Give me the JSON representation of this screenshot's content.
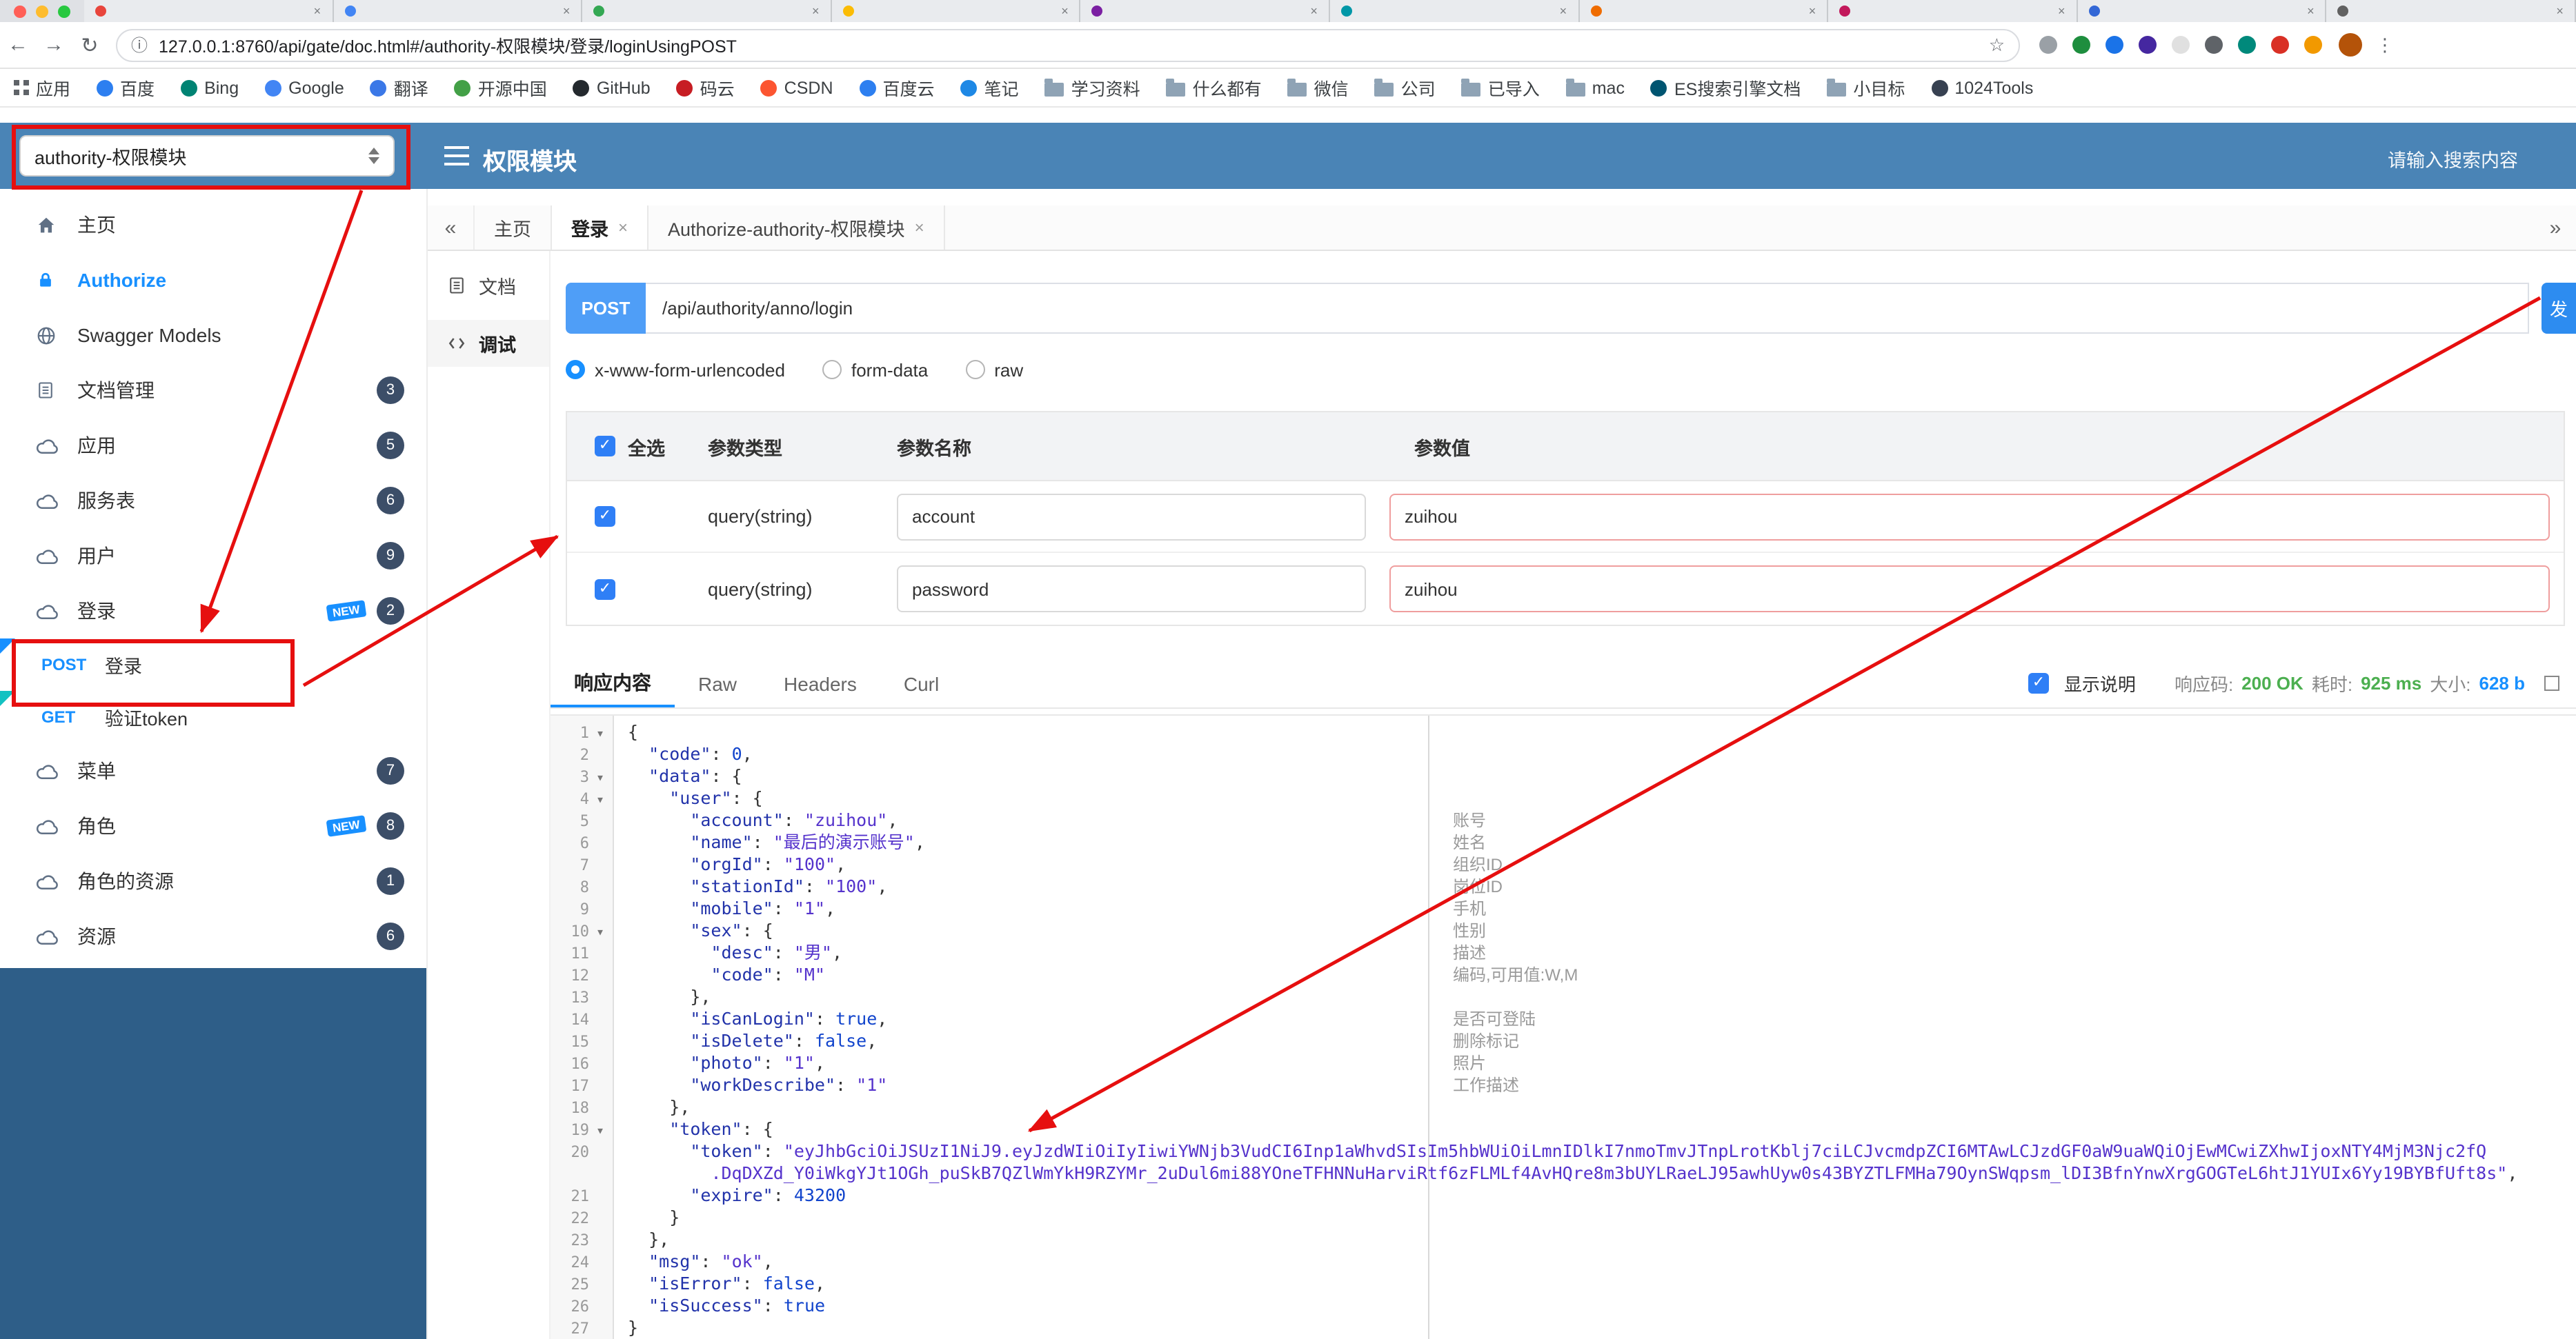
{
  "glyphs": {
    "close": "×",
    "fold": "▾",
    "collapse": "«",
    "more": "»",
    "back": "←",
    "forward": "→",
    "reload": "↻",
    "info": "ⓘ",
    "star": "☆",
    "overflow": "⋮",
    "check": "✓"
  },
  "colors": {
    "header_blue": "#4a84b6",
    "sidebar_dark": "#2e5e88",
    "accent": "#1890ff",
    "annotation_red": "#e60f0f",
    "status_green": "#4caf50"
  },
  "browser": {
    "url": "127.0.0.1:8760/api/gate/doc.html#/authority-权限模块/登录/loginUsingPOST",
    "traffic_lights": [
      "#ff5f57",
      "#febc2e",
      "#28c840"
    ],
    "tab_favicons": [
      "#e8453c",
      "#4285f4",
      "#34a853",
      "#fbbc05",
      "#7b1fa2",
      "#0097a7",
      "#ef6c00",
      "#c2185b",
      "#3367d6",
      "#616161"
    ],
    "ext_icon_colors": [
      "#9aa0a6",
      "#1e8e3e",
      "#1a73e8",
      "#4527a0",
      "#e0e0e0",
      "#5f6368",
      "#00897b",
      "#d93025",
      "#f29900"
    ],
    "bookmarks": [
      {
        "label": "应用",
        "icon": "apps"
      },
      {
        "label": "百度",
        "icon": "site",
        "color": "#2d7ff0"
      },
      {
        "label": "Bing",
        "icon": "site",
        "color": "#008373"
      },
      {
        "label": "Google",
        "icon": "site",
        "color": "#4285f4"
      },
      {
        "label": "翻译",
        "icon": "site",
        "color": "#3b78e7"
      },
      {
        "label": "开源中国",
        "icon": "site",
        "color": "#43a047"
      },
      {
        "label": "GitHub",
        "icon": "site",
        "color": "#24292e"
      },
      {
        "label": "码云",
        "icon": "site",
        "color": "#c71d23"
      },
      {
        "label": "CSDN",
        "icon": "site",
        "color": "#fc5531"
      },
      {
        "label": "百度云",
        "icon": "site",
        "color": "#2d7ff0"
      },
      {
        "label": "笔记",
        "icon": "site",
        "color": "#1e88e5"
      },
      {
        "label": "学习资料",
        "icon": "folder"
      },
      {
        "label": "什么都有",
        "icon": "folder"
      },
      {
        "label": "微信",
        "icon": "folder"
      },
      {
        "label": "公司",
        "icon": "folder"
      },
      {
        "label": "已导入",
        "icon": "folder"
      },
      {
        "label": "mac",
        "icon": "folder"
      },
      {
        "label": "ES搜索引擎文档",
        "icon": "site",
        "color": "#005571"
      },
      {
        "label": "小目标",
        "icon": "folder"
      },
      {
        "label": "1024Tools",
        "icon": "site",
        "color": "#374151"
      }
    ]
  },
  "header": {
    "module_select": "authority-权限模块",
    "title": "权限模块",
    "search_placeholder": "请输入搜索内容"
  },
  "sidebar": {
    "new_label": "NEW",
    "items": [
      {
        "label": "主页",
        "icon": "home"
      },
      {
        "label": "Authorize",
        "icon": "lock",
        "accent": true
      },
      {
        "label": "Swagger Models",
        "icon": "globe"
      },
      {
        "label": "文档管理",
        "icon": "doc",
        "badge": "3"
      },
      {
        "label": "应用",
        "icon": "cloud",
        "badge": "5"
      },
      {
        "label": "服务表",
        "icon": "cloud",
        "badge": "6"
      },
      {
        "label": "用户",
        "icon": "cloud",
        "badge": "9"
      },
      {
        "label": "登录",
        "icon": "cloud",
        "badge": "2",
        "isNew": true
      },
      {
        "method": "POST",
        "label": "登录",
        "ribbon": "#1890ff"
      },
      {
        "method": "GET",
        "label": "验证token",
        "ribbon": "#13c2c2"
      },
      {
        "label": "菜单",
        "icon": "cloud",
        "badge": "7"
      },
      {
        "label": "角色",
        "icon": "cloud",
        "badge": "8",
        "isNew": true
      },
      {
        "label": "角色的资源",
        "icon": "cloud",
        "badge": "1"
      },
      {
        "label": "资源",
        "icon": "cloud",
        "badge": "6"
      }
    ]
  },
  "tabs": {
    "items": [
      {
        "label": "主页",
        "closable": false
      },
      {
        "label": "登录",
        "closable": true,
        "active": true
      },
      {
        "label": "Authorize-authority-权限模块",
        "closable": true
      }
    ]
  },
  "doc_menu": [
    {
      "label": "文档",
      "icon": "doc"
    },
    {
      "label": "调试",
      "icon": "debug",
      "active": true
    }
  ],
  "debug": {
    "method": "POST",
    "url": "/api/authority/anno/login",
    "send_label": "发",
    "content_types": [
      {
        "label": "x-www-form-urlencoded",
        "checked": true
      },
      {
        "label": "form-data",
        "checked": false
      },
      {
        "label": "raw",
        "checked": false
      }
    ],
    "params_table": {
      "headers": [
        "全选",
        "参数类型",
        "参数名称",
        "参数值"
      ],
      "rows": [
        {
          "checked": true,
          "type": "query(string)",
          "name": "account",
          "value": "zuihou"
        },
        {
          "checked": true,
          "type": "query(string)",
          "name": "password",
          "value": "zuihou"
        }
      ]
    }
  },
  "response": {
    "tabs": [
      "响应内容",
      "Raw",
      "Headers",
      "Curl"
    ],
    "active_tab": "响应内容",
    "show_desc_label": "显示说明",
    "status_label": "响应码:",
    "status_value": "200 OK",
    "time_label": "耗时:",
    "time_value": "925 ms",
    "size_label": "大小:",
    "size_value": "628 b"
  },
  "code": {
    "lines": [
      {
        "n": "1",
        "fold": true,
        "pre": "",
        "tok": [
          [
            "p",
            "{"
          ]
        ]
      },
      {
        "n": "2",
        "pre": "  ",
        "tok": [
          [
            "k",
            "\"code\""
          ],
          [
            "p",
            ": "
          ],
          [
            "num",
            "0"
          ],
          [
            "p",
            ","
          ]
        ]
      },
      {
        "n": "3",
        "fold": true,
        "pre": "  ",
        "tok": [
          [
            "k",
            "\"data\""
          ],
          [
            "p",
            ": {"
          ]
        ]
      },
      {
        "n": "4",
        "fold": true,
        "pre": "    ",
        "tok": [
          [
            "k",
            "\"user\""
          ],
          [
            "p",
            ": {"
          ]
        ]
      },
      {
        "n": "5",
        "pre": "      ",
        "tok": [
          [
            "k",
            "\"account\""
          ],
          [
            "p",
            ": "
          ],
          [
            "s",
            "\"zuihou\""
          ],
          [
            "p",
            ","
          ]
        ],
        "desc": "账号"
      },
      {
        "n": "6",
        "pre": "      ",
        "tok": [
          [
            "k",
            "\"name\""
          ],
          [
            "p",
            ": "
          ],
          [
            "s",
            "\"最后的演示账号\""
          ],
          [
            "p",
            ","
          ]
        ],
        "desc": "姓名"
      },
      {
        "n": "7",
        "pre": "      ",
        "tok": [
          [
            "k",
            "\"orgId\""
          ],
          [
            "p",
            ": "
          ],
          [
            "s",
            "\"100\""
          ],
          [
            "p",
            ","
          ]
        ],
        "desc": "组织ID"
      },
      {
        "n": "8",
        "pre": "      ",
        "tok": [
          [
            "k",
            "\"stationId\""
          ],
          [
            "p",
            ": "
          ],
          [
            "s",
            "\"100\""
          ],
          [
            "p",
            ","
          ]
        ],
        "desc": "岗位ID"
      },
      {
        "n": "9",
        "pre": "      ",
        "tok": [
          [
            "k",
            "\"mobile\""
          ],
          [
            "p",
            ": "
          ],
          [
            "s",
            "\"1\""
          ],
          [
            "p",
            ","
          ]
        ],
        "desc": "手机"
      },
      {
        "n": "10",
        "fold": true,
        "pre": "      ",
        "tok": [
          [
            "k",
            "\"sex\""
          ],
          [
            "p",
            ": {"
          ]
        ],
        "desc": "性别"
      },
      {
        "n": "11",
        "pre": "        ",
        "tok": [
          [
            "k",
            "\"desc\""
          ],
          [
            "p",
            ": "
          ],
          [
            "s",
            "\"男\""
          ],
          [
            "p",
            ","
          ]
        ],
        "desc": "描述"
      },
      {
        "n": "12",
        "pre": "        ",
        "tok": [
          [
            "k",
            "\"code\""
          ],
          [
            "p",
            ": "
          ],
          [
            "s",
            "\"M\""
          ]
        ],
        "desc": "编码,可用值:W,M"
      },
      {
        "n": "13",
        "pre": "      ",
        "tok": [
          [
            "p",
            "},"
          ]
        ]
      },
      {
        "n": "14",
        "pre": "      ",
        "tok": [
          [
            "k",
            "\"isCanLogin\""
          ],
          [
            "p",
            ": "
          ],
          [
            "b",
            "true"
          ],
          [
            "p",
            ","
          ]
        ],
        "desc": "是否可登陆"
      },
      {
        "n": "15",
        "pre": "      ",
        "tok": [
          [
            "k",
            "\"isDelete\""
          ],
          [
            "p",
            ": "
          ],
          [
            "b",
            "false"
          ],
          [
            "p",
            ","
          ]
        ],
        "desc": "删除标记"
      },
      {
        "n": "16",
        "pre": "      ",
        "tok": [
          [
            "k",
            "\"photo\""
          ],
          [
            "p",
            ": "
          ],
          [
            "s",
            "\"1\""
          ],
          [
            "p",
            ","
          ]
        ],
        "desc": "照片"
      },
      {
        "n": "17",
        "pre": "      ",
        "tok": [
          [
            "k",
            "\"workDescribe\""
          ],
          [
            "p",
            ": "
          ],
          [
            "s",
            "\"1\""
          ]
        ],
        "desc": "工作描述"
      },
      {
        "n": "18",
        "pre": "    ",
        "tok": [
          [
            "p",
            "},"
          ]
        ]
      },
      {
        "n": "19",
        "fold": true,
        "pre": "    ",
        "tok": [
          [
            "k",
            "\"token\""
          ],
          [
            "p",
            ": {"
          ]
        ]
      },
      {
        "n": "20",
        "pre": "      ",
        "tok": [
          [
            "k",
            "\"token\""
          ],
          [
            "p",
            ": "
          ],
          [
            "s",
            "\"eyJhbGciOiJSUzI1NiJ9.eyJzdWIiOiIyIiwiYWNjb3VudCI6Inp1aWhvdSIsIm5hbWUiOiLmnIDlkI7nmoTmvJTnpLrotKblj7ciLCJvcmdpZCI6MTAwLCJzdGF0aW9uaWQiOjEwMCwiZXhwIjoxNTY4MjM3Njc2fQ"
          ]
        ]
      },
      {
        "n": "",
        "pre": "        ",
        "tok": [
          [
            "s",
            ".DqDXZd_Y0iWkgYJt1OGh_puSkB7QZlWmYkH9RZYMr_2uDul6mi88YOneTFHNNuHarviRtf6zFLMLf4AvHQre8m3bUYLRaeLJ95awhUyw0s43BYZTLFMHa79OynSWqpsm_lDI3BfnYnwXrgGOGTeL6htJ1YUIx6Yy19BYBfUft8s\""
          ],
          [
            "p",
            ","
          ]
        ]
      },
      {
        "n": "21",
        "pre": "      ",
        "tok": [
          [
            "k",
            "\"expire\""
          ],
          [
            "p",
            ": "
          ],
          [
            "num",
            "43200"
          ]
        ]
      },
      {
        "n": "22",
        "pre": "    ",
        "tok": [
          [
            "p",
            "}"
          ]
        ]
      },
      {
        "n": "23",
        "pre": "  ",
        "tok": [
          [
            "p",
            "},"
          ]
        ]
      },
      {
        "n": "24",
        "pre": "  ",
        "tok": [
          [
            "k",
            "\"msg\""
          ],
          [
            "p",
            ": "
          ],
          [
            "s",
            "\"ok\""
          ],
          [
            "p",
            ","
          ]
        ]
      },
      {
        "n": "25",
        "pre": "  ",
        "tok": [
          [
            "k",
            "\"isError\""
          ],
          [
            "p",
            ": "
          ],
          [
            "b",
            "false"
          ],
          [
            "p",
            ","
          ]
        ]
      },
      {
        "n": "26",
        "pre": "  ",
        "tok": [
          [
            "k",
            "\"isSuccess\""
          ],
          [
            "p",
            ": "
          ],
          [
            "b",
            "true"
          ]
        ]
      },
      {
        "n": "27",
        "pre": "",
        "tok": [
          [
            "p",
            "}"
          ]
        ]
      }
    ]
  }
}
